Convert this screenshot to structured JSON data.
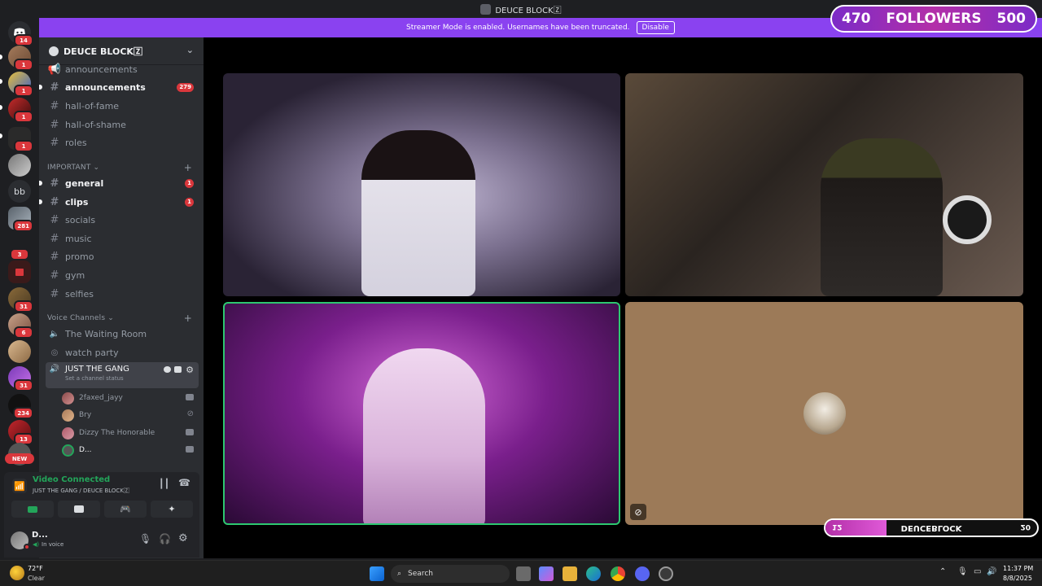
{
  "titlebar": {
    "title": "DEUCE BLOCK🅉"
  },
  "banner": {
    "text": "Streamer Mode is enabled. Usernames have been truncated.",
    "button": "Disable"
  },
  "overlay": {
    "followers_current": "470",
    "followers_label": "FOLLOWERS",
    "followers_goal": "500",
    "name_left": "12",
    "name_center": "DEUCEBLOCK",
    "name_right": "20"
  },
  "rail": {
    "badges": [
      "14",
      "1",
      "1",
      "1",
      "1",
      "281",
      "3",
      "31",
      "6",
      "31",
      "234",
      "13"
    ],
    "text_icon": "bb",
    "new_label": "NEW"
  },
  "server": {
    "name": "DEUCE BLOCK🅉"
  },
  "channels": {
    "top": [
      {
        "name": "announcements",
        "icon": "megaphone-icon"
      },
      {
        "name": "announcements",
        "count": "279",
        "unread": true
      },
      {
        "name": "hall-of-fame"
      },
      {
        "name": "hall-of-shame"
      },
      {
        "name": "roles"
      }
    ],
    "important_label": "IMPORTANT",
    "important": [
      {
        "name": "general",
        "count": "1",
        "unread": true
      },
      {
        "name": "clips",
        "count": "1",
        "unread": true
      },
      {
        "name": "socials"
      },
      {
        "name": "music"
      },
      {
        "name": "promo"
      },
      {
        "name": "gym"
      },
      {
        "name": "selfies"
      }
    ],
    "voice_label": "Voice Channels",
    "voice": [
      {
        "name": "The Waiting Room"
      },
      {
        "name": "watch party"
      },
      {
        "name": "JUST THE GANG",
        "status": "Set a channel status"
      }
    ],
    "voice_users": [
      {
        "name": "2faxed_jayy"
      },
      {
        "name": "Bry"
      },
      {
        "name": "Dizzy The Honorable"
      },
      {
        "name": "D..."
      }
    ]
  },
  "voice_panel": {
    "status": "Video Connected",
    "location": "JUST THE GANG / DEUCE BLOCK🅉"
  },
  "user_panel": {
    "name": "D...",
    "status": "In voice"
  },
  "taskbar": {
    "weather_temp": "72°F",
    "weather_desc": "Clear",
    "search": "Search",
    "time": "11:37 PM",
    "date": "8/8/2025"
  },
  "colors": {
    "accent": "#8a42f0",
    "danger": "#da373c",
    "connected": "#23a55a",
    "active_speaker": "#2dc770"
  }
}
